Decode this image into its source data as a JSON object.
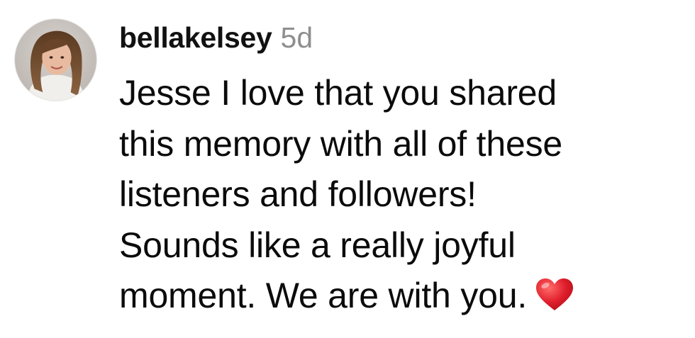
{
  "comment": {
    "username": "bellakelsey",
    "timestamp": "5d",
    "avatar_icon": "profile-photo",
    "lines": [
      "Jesse I love that you shared",
      "this memory with all of these",
      "listeners and followers!",
      "Sounds like a really joyful",
      "moment. We are with you."
    ],
    "emoji": "red-heart-icon"
  }
}
